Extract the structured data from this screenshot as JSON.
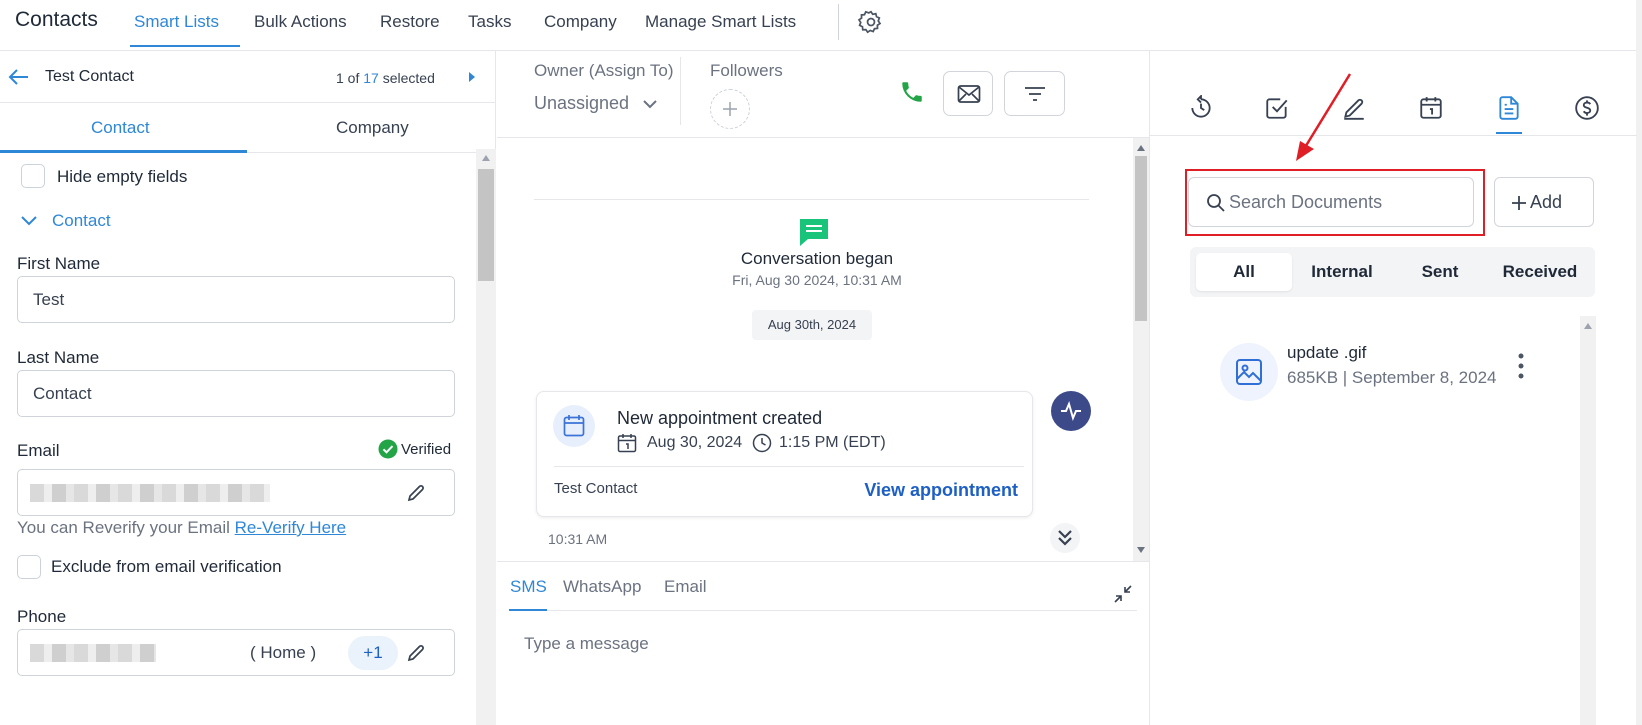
{
  "topnav": {
    "title": "Contacts",
    "items": [
      "Smart Lists",
      "Bulk Actions",
      "Restore",
      "Tasks",
      "Company",
      "Manage Smart Lists"
    ],
    "active": "Smart Lists"
  },
  "contact_panel": {
    "name": "Test Contact",
    "selection": {
      "index": "1 of",
      "total": "17",
      "suffix": "selected"
    },
    "tabs": [
      "Contact",
      "Company"
    ],
    "hide_empty_label": "Hide empty fields",
    "section_title": "Contact",
    "first_name": {
      "label": "First Name",
      "value": "Test"
    },
    "last_name": {
      "label": "Last Name",
      "value": "Contact"
    },
    "email": {
      "label": "Email",
      "verified_label": "Verified",
      "reverify_text": "You can Reverify your Email",
      "reverify_link": "Re-Verify Here"
    },
    "exclude_label": "Exclude from email verification",
    "phone": {
      "label": "Phone",
      "type": "( Home )",
      "extra": "+1"
    }
  },
  "conversation": {
    "owner_label": "Owner (Assign To)",
    "owner_value": "Unassigned",
    "followers_label": "Followers",
    "began_title": "Conversation began",
    "began_time": "Fri, Aug 30 2024, 10:31 AM",
    "date_chip": "Aug 30th, 2024",
    "appointment": {
      "title": "New appointment created",
      "date": "Aug 30, 2024",
      "time": "1:15 PM (EDT)",
      "contact": "Test Contact",
      "link": "View appointment"
    },
    "last_time": "10:31 AM",
    "channels": [
      "SMS",
      "WhatsApp",
      "Email"
    ],
    "active_channel": "SMS",
    "message_placeholder": "Type a message"
  },
  "documents": {
    "search_placeholder": "Search Documents",
    "add_label": "Add",
    "filters": [
      "All",
      "Internal",
      "Sent",
      "Received"
    ],
    "active_filter": "All",
    "files": [
      {
        "name": "update .gif",
        "meta": "685KB | September 8, 2024"
      }
    ]
  },
  "colors": {
    "accent": "#2f87d7",
    "verified": "#22a447",
    "phone": "#22a447",
    "highlight": "#e01e26",
    "activity": "#3d4a8a",
    "link": "#1d5fc4"
  }
}
